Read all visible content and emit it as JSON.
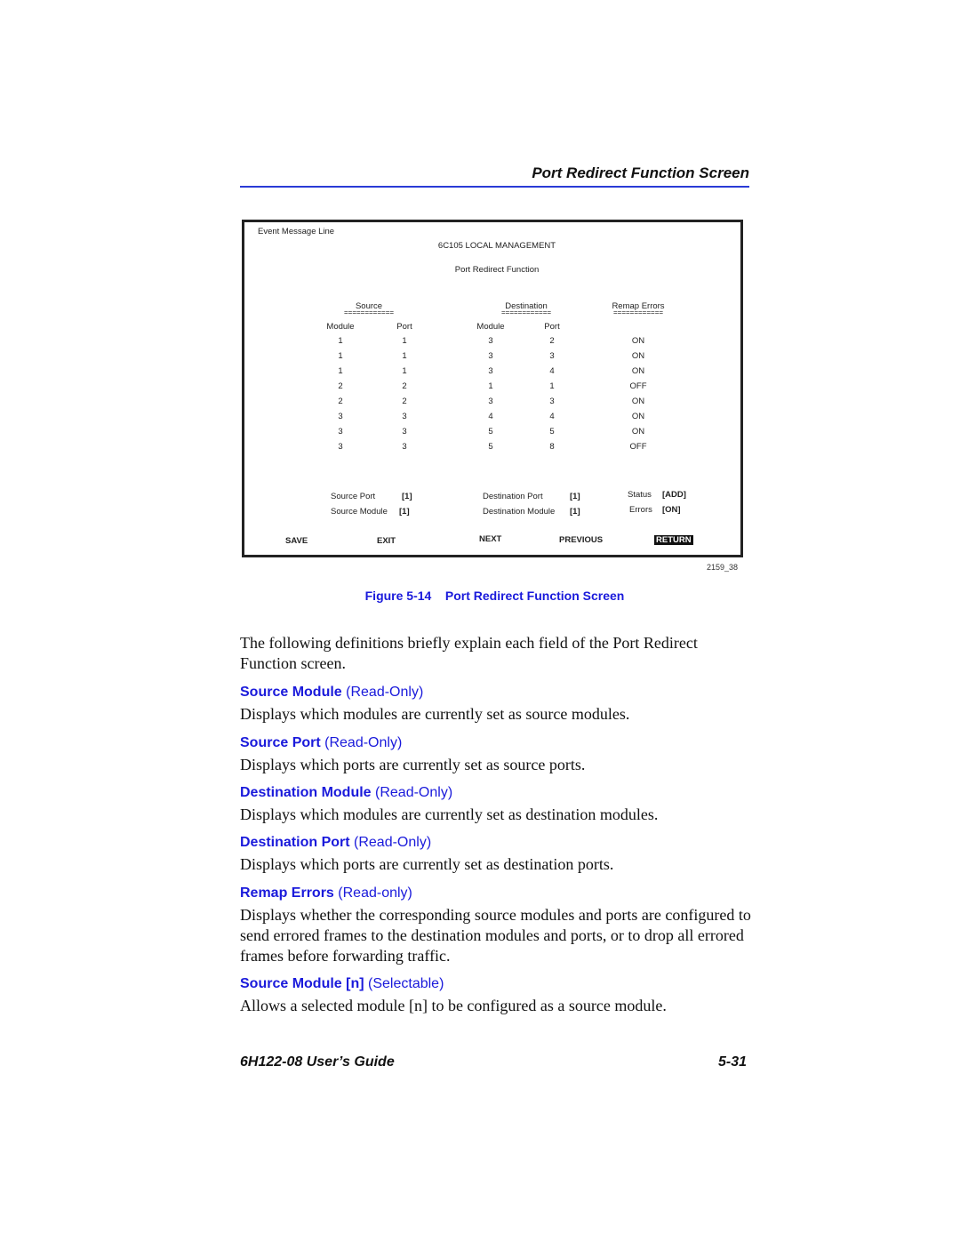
{
  "header": {
    "title": "Port Redirect Function Screen"
  },
  "screen": {
    "event_line": "Event Message Line",
    "title": "6C105 LOCAL MANAGEMENT",
    "subtitle": "Port Redirect Function",
    "groups": {
      "source": "Source",
      "destination": "Destination",
      "remap": "Remap Errors",
      "underline": "============"
    },
    "columns": {
      "src_module": "Module",
      "src_port": "Port",
      "dst_module": "Module",
      "dst_port": "Port"
    },
    "rows": [
      {
        "src_module": "1",
        "src_port": "1",
        "dst_module": "3",
        "dst_port": "2",
        "remap": "ON"
      },
      {
        "src_module": "1",
        "src_port": "1",
        "dst_module": "3",
        "dst_port": "3",
        "remap": "ON"
      },
      {
        "src_module": "1",
        "src_port": "1",
        "dst_module": "3",
        "dst_port": "4",
        "remap": "ON"
      },
      {
        "src_module": "2",
        "src_port": "2",
        "dst_module": "1",
        "dst_port": "1",
        "remap": "OFF"
      },
      {
        "src_module": "2",
        "src_port": "2",
        "dst_module": "3",
        "dst_port": "3",
        "remap": "ON"
      },
      {
        "src_module": "3",
        "src_port": "3",
        "dst_module": "4",
        "dst_port": "4",
        "remap": "ON"
      },
      {
        "src_module": "3",
        "src_port": "3",
        "dst_module": "5",
        "dst_port": "5",
        "remap": "ON"
      },
      {
        "src_module": "3",
        "src_port": "3",
        "dst_module": "5",
        "dst_port": "8",
        "remap": "OFF"
      }
    ],
    "fields": {
      "source_port_label": "Source Port",
      "source_port_value": "[1]",
      "source_module_label": "Source Module",
      "source_module_value": "[1]",
      "dest_port_label": "Destination Port",
      "dest_port_value": "[1]",
      "dest_module_label": "Destination Module",
      "dest_module_value": "[1]",
      "status_label": "Status",
      "status_value": "[ADD]",
      "errors_label": "Errors",
      "errors_value": "[ON]"
    },
    "commands": {
      "save": "SAVE",
      "exit": "EXIT",
      "next": "NEXT",
      "previous": "PREVIOUS",
      "return": "RETURN"
    }
  },
  "figure_id": "2159_38",
  "caption": "Figure 5-14    Port Redirect Function Screen",
  "intro": "The following definitions briefly explain each field of the Port Redirect Function screen.",
  "definitions": [
    {
      "term": "Source Module",
      "qualifier": "(Read-Only)",
      "text": "Displays which modules are currently set as source modules."
    },
    {
      "term": "Source Port",
      "qualifier": "(Read-Only)",
      "text": "Displays which ports are currently set as source ports."
    },
    {
      "term": "Destination Module",
      "qualifier": "(Read-Only)",
      "text": "Displays which modules are currently set as destination modules."
    },
    {
      "term": "Destination Port",
      "qualifier": "(Read-Only)",
      "text": "Displays which ports are currently set as destination ports."
    },
    {
      "term": "Remap Errors",
      "qualifier": "(Read-only)",
      "text": "Displays whether the corresponding source modules and ports are configured to send errored frames to the destination modules and ports, or to drop all errored frames before forwarding traffic."
    },
    {
      "term": "Source Module [n]",
      "qualifier": "(Selectable)",
      "text": "Allows a selected module [n] to be configured as a source module."
    }
  ],
  "footer": {
    "guide": "6H122-08 User’s Guide",
    "page": "5-31"
  }
}
